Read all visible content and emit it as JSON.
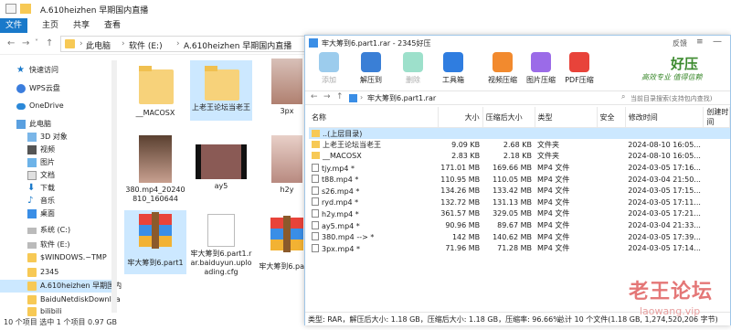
{
  "explorer": {
    "title": "A.610heizhen 早期国内直播",
    "ribbon_tabs": [
      "文件",
      "主页",
      "共享",
      "查看"
    ],
    "breadcrumb": [
      "此电脑",
      "软件 (E:)",
      "A.610heizhen 早期国内直播"
    ],
    "sidebar": [
      {
        "label": "快速访问"
      },
      {
        "label": "WPS云盘"
      },
      {
        "label": "OneDrive"
      },
      {
        "label": "此电脑"
      },
      {
        "label": "3D 对象"
      },
      {
        "label": "视频"
      },
      {
        "label": "图片"
      },
      {
        "label": "文档"
      },
      {
        "label": "下载"
      },
      {
        "label": "音乐"
      },
      {
        "label": "桌面"
      },
      {
        "label": "系统 (C:)"
      },
      {
        "label": "软件 (E:)"
      },
      {
        "label": "$WINDOWS.~TMP"
      },
      {
        "label": "2345"
      },
      {
        "label": "A.610heizhen 早期国内"
      },
      {
        "label": "BaiduNetdiskDownloa"
      },
      {
        "label": "bilibili"
      }
    ],
    "files": [
      {
        "name": "__MACOSX"
      },
      {
        "name": "上老王论坛当老王"
      },
      {
        "name": "3px"
      },
      {
        "name": "380.mp4_20240810_160644"
      },
      {
        "name": "ay5"
      },
      {
        "name": "h2y"
      },
      {
        "name": "牢大筹到6.part1"
      },
      {
        "name": "牢大筹到6.part1.rar.baiduyun.uploading.cfg"
      },
      {
        "name": "牢大筹到6.part1"
      }
    ],
    "status": "10 个项目   选中 1 个项目  0.97 GB"
  },
  "haozip": {
    "title": "牢大筹到6.part1.rar - 2345好压",
    "feedback": "反馈",
    "toolbar": [
      "添加",
      "解压到",
      "删除",
      "工具箱",
      "视频压缩",
      "图片压缩",
      "PDF压缩"
    ],
    "brand": "好压",
    "slogan": "高效专业  值得信赖",
    "path": "牢大筹到6.part1.rar",
    "search_placeholder": "当前目录搜索(支持包内查找)",
    "columns": [
      "名称",
      "大小",
      "压缩后大小",
      "类型",
      "安全",
      "修改时间",
      "创建时间"
    ],
    "rows": [
      {
        "name": "..(上层目录)",
        "size": "",
        "packed": "",
        "type": "",
        "mtime": "",
        "ctime": ""
      },
      {
        "name": "上老王论坛当老王",
        "size": "9.09 KB",
        "packed": "2.68 KB",
        "type": "文件夹",
        "mtime": "2024-08-10 16:05...",
        "ctime": ""
      },
      {
        "name": "__MACOSX",
        "size": "2.83 KB",
        "packed": "2.18 KB",
        "type": "文件夹",
        "mtime": "2024-08-10 16:05...",
        "ctime": ""
      },
      {
        "name": "tjy.mp4 *",
        "size": "171.01 MB",
        "packed": "169.66 MB",
        "type": "MP4 文件",
        "mtime": "2024-03-05 17:16...",
        "ctime": ""
      },
      {
        "name": "t88.mp4 *",
        "size": "110.95 MB",
        "packed": "110.05 MB",
        "type": "MP4 文件",
        "mtime": "2024-03-04 21:50...",
        "ctime": ""
      },
      {
        "name": "s26.mp4 *",
        "size": "134.26 MB",
        "packed": "133.42 MB",
        "type": "MP4 文件",
        "mtime": "2024-03-05 17:15...",
        "ctime": ""
      },
      {
        "name": "ryd.mp4 *",
        "size": "132.72 MB",
        "packed": "131.13 MB",
        "type": "MP4 文件",
        "mtime": "2024-03-05 17:11...",
        "ctime": ""
      },
      {
        "name": "h2y.mp4 *",
        "size": "361.57 MB",
        "packed": "329.05 MB",
        "type": "MP4 文件",
        "mtime": "2024-03-05 17:21...",
        "ctime": ""
      },
      {
        "name": "ay5.mp4 *",
        "size": "90.96 MB",
        "packed": "89.67 MB",
        "type": "MP4 文件",
        "mtime": "2024-03-04 21:33...",
        "ctime": ""
      },
      {
        "name": "380.mp4 --> *",
        "size": "142 MB",
        "packed": "140.62 MB",
        "type": "MP4 文件",
        "mtime": "2024-03-05 17:39...",
        "ctime": ""
      },
      {
        "name": "3px.mp4 *",
        "size": "71.96 MB",
        "packed": "71.28 MB",
        "type": "MP4 文件",
        "mtime": "2024-03-05 17:14...",
        "ctime": ""
      }
    ],
    "status": "类型: RAR，解压后大小: 1.18 GB，压缩后大小: 1.18 GB，压缩率: 96.66%",
    "status_right": "总计 10 个文件(1.18 GB, 1,274,520,206 字节)"
  },
  "watermark": {
    "text": "老王论坛",
    "sub": "laowang.vip"
  },
  "colors": {
    "accent": "#0063b1",
    "selection": "#cce8ff",
    "folder": "#f7c955",
    "watermark": "#e06060"
  }
}
